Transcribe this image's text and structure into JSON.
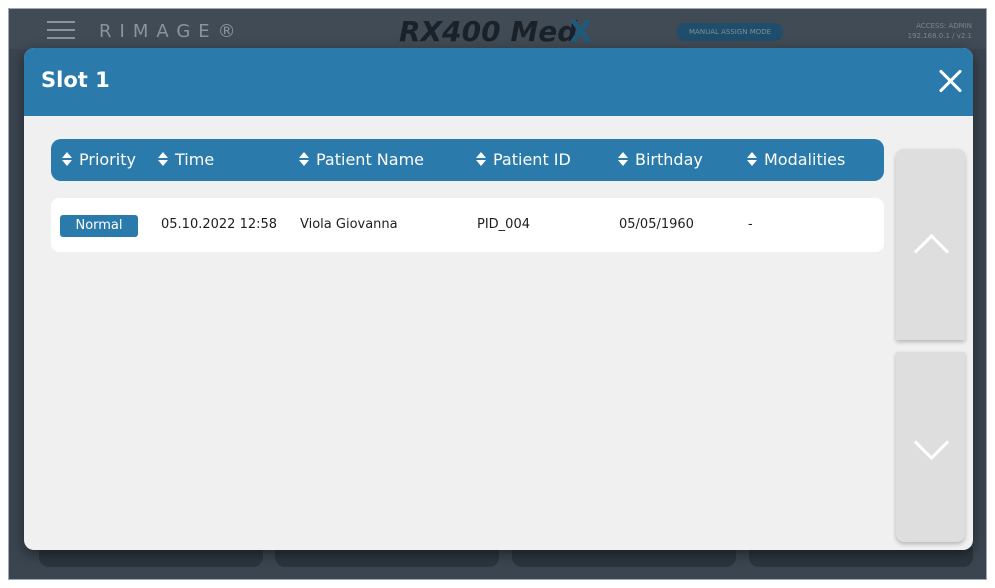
{
  "background": {
    "logo": "RIMAGE®",
    "product_name": "RX400 Med",
    "product_mark": "X",
    "mode_badge": "MANUAL ASSIGN MODE",
    "right_info_line1": "ACCESS: ADMIN",
    "right_info_line2": "192.168.0.1 / v2.1"
  },
  "modal": {
    "title": "Slot 1",
    "close_icon": "close-icon",
    "header_color": "#2a7aab"
  },
  "table": {
    "columns": [
      "Priority",
      "Time",
      "Patient Name",
      "Patient ID",
      "Birthday",
      "Modalities"
    ],
    "rows": [
      {
        "priority": "Normal",
        "time": "05.10.2022 12:58",
        "patient_name": "Viola Giovanna",
        "patient_id": "PID_004",
        "birthday": "05/05/1960",
        "modalities": "-"
      }
    ]
  },
  "scroll": {
    "up_icon": "chevron-up-icon",
    "down_icon": "chevron-down-icon"
  }
}
